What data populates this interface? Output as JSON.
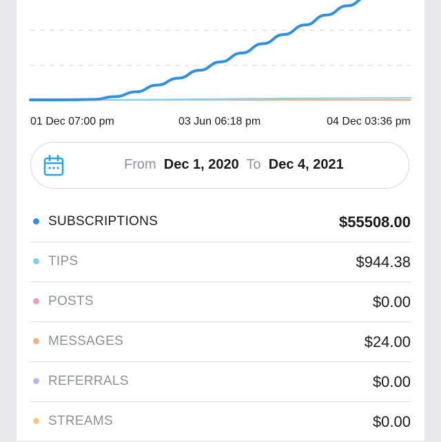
{
  "chart_data": {
    "type": "line",
    "x_ticks": [
      "01 Dec 07:00 pm",
      "03 Jun 06:18 pm",
      "04 Dec 03:36 pm"
    ],
    "series": [
      {
        "color": "#2f8fe0",
        "values": [
          0,
          0,
          20,
          200,
          1500,
          3800,
          7000,
          10300,
          14000,
          18000,
          22200,
          26600,
          31000,
          35500,
          40200,
          44600,
          49000,
          53200,
          55508
        ]
      },
      {
        "color": "#7fd2ea",
        "values": [
          0,
          0,
          0,
          5,
          30,
          80,
          150,
          230,
          320,
          420,
          520,
          600,
          660,
          730,
          790,
          840,
          880,
          920,
          944.38
        ]
      },
      {
        "color": "#f0b08c",
        "values": [
          0,
          0,
          0,
          0,
          0,
          0,
          24,
          24,
          24,
          24,
          24,
          24,
          24,
          24,
          24,
          24,
          24,
          24,
          24
        ]
      }
    ]
  },
  "date_range": {
    "from_label": "From",
    "from_value": "Dec 1, 2020",
    "to_label": "To",
    "to_value": "Dec 4, 2021"
  },
  "earnings": [
    {
      "label": "SUBSCRIPTIONS",
      "amount": "$55508.00",
      "color": "#2f8fe0",
      "active": true
    },
    {
      "label": "TIPS",
      "amount": "$944.38",
      "color": "#7fd2ea",
      "active": false
    },
    {
      "label": "POSTS",
      "amount": "$0.00",
      "color": "#f0a0b8",
      "active": false
    },
    {
      "label": "MESSAGES",
      "amount": "$24.00",
      "color": "#f0b08c",
      "active": false
    },
    {
      "label": "REFERRALS",
      "amount": "$0.00",
      "color": "#c4b2e6",
      "active": false
    },
    {
      "label": "STREAMS",
      "amount": "$0.00",
      "color": "#f7c77e",
      "active": false
    }
  ]
}
